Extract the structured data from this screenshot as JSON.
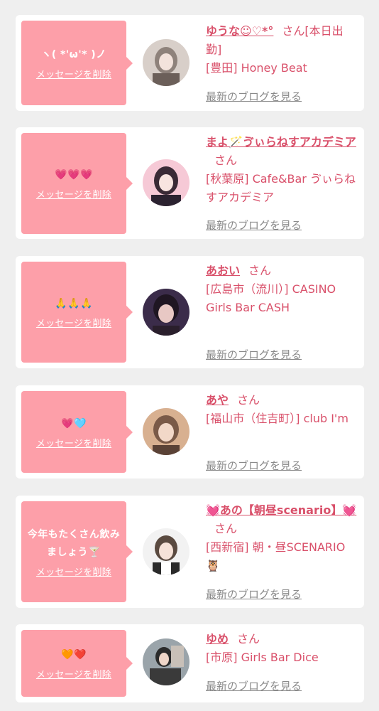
{
  "cards": [
    {
      "message": "ヽ( *'ω'* )ノ",
      "delete_label": "メッセージを削除",
      "name": "ゆうな☺♡*°",
      "honorific": "さん[本日出勤]",
      "shop": "[豊田] Honey Beat",
      "blog_label": "最新のブログを見る",
      "avatar_colors": [
        "#d8cfc9",
        "#8e827b"
      ]
    },
    {
      "message": "💗💗💗",
      "delete_label": "メッセージを削除",
      "name": "まよ🪄ゔぃらねすアカデミア",
      "honorific": "さん",
      "shop": "[秋葉原] Cafe&Bar ゔぃらねすアカデミア",
      "blog_label": "最新のブログを見る",
      "avatar_colors": [
        "#f6c9d6",
        "#3a2a36"
      ]
    },
    {
      "message": "🙏🙏🙏",
      "delete_label": "メッセージを削除",
      "name": "あおい",
      "honorific": "さん",
      "shop": "[広島市（流川）] CASINO Girls Bar CASH",
      "blog_label": "最新のブログを見る",
      "avatar_colors": [
        "#3b2c4a",
        "#e8c8c4"
      ]
    },
    {
      "message": "💗🩵",
      "delete_label": "メッセージを削除",
      "name": "あや",
      "honorific": "さん",
      "shop": "[福山市（住吉町）] club I'm",
      "blog_label": "最新のブログを見る",
      "avatar_colors": [
        "#d8b090",
        "#7a5a48"
      ]
    },
    {
      "message": "今年もたくさん飲みましょう🍸",
      "delete_label": "メッセージを削除",
      "name": "💓あの【朝昼scenario】💓",
      "honorific": "さん",
      "shop": "[西新宿] 朝・昼SCENARIO🦉",
      "blog_label": "最新のブログを見る",
      "avatar_colors": [
        "#f2f2f2",
        "#2a2a2a"
      ]
    },
    {
      "message": "🧡❤️",
      "delete_label": "メッセージを削除",
      "name": "ゆめ",
      "honorific": "さん",
      "shop": "[市原] Girls Bar Dice",
      "blog_label": "最新のブログを見る",
      "avatar_colors": [
        "#9aa4aa",
        "#2b2b2b"
      ]
    }
  ]
}
